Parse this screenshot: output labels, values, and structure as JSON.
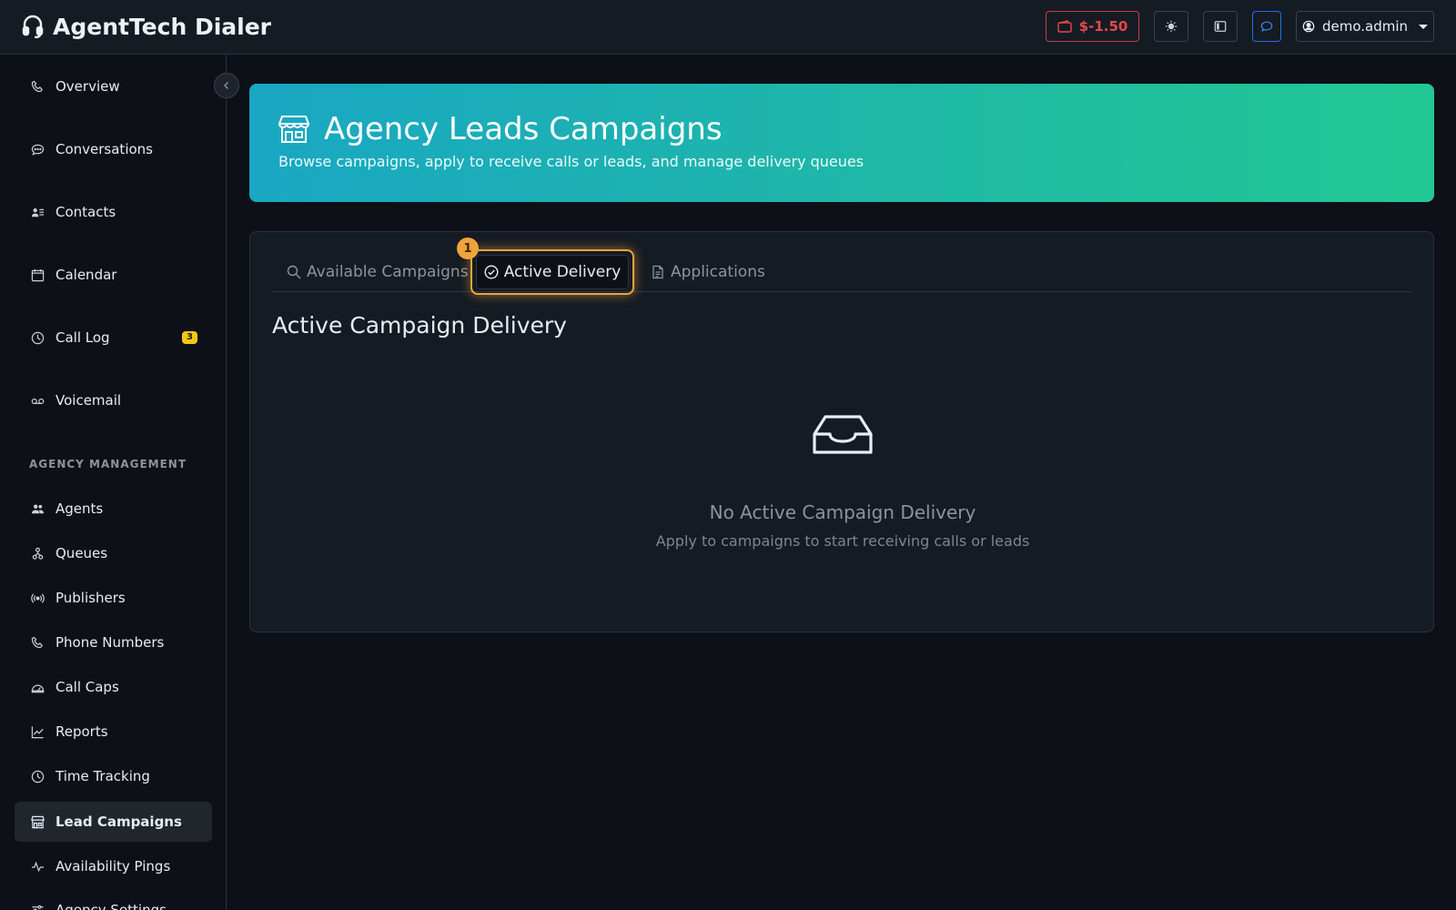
{
  "app": {
    "title": "AgentTech Dialer"
  },
  "header": {
    "wallet_balance": "$-1.50",
    "user_label": "demo.admin"
  },
  "sidebar": {
    "items": [
      {
        "label": "Overview",
        "icon": "phone-icon"
      },
      {
        "label": "Conversations",
        "icon": "chat-icon"
      },
      {
        "label": "Contacts",
        "icon": "contacts-icon"
      },
      {
        "label": "Calendar",
        "icon": "calendar-icon"
      },
      {
        "label": "Call Log",
        "icon": "clock-icon",
        "badge": "3"
      },
      {
        "label": "Voicemail",
        "icon": "voicemail-icon"
      }
    ],
    "section_title": "AGENCY MANAGEMENT",
    "management_items": [
      {
        "label": "Agents",
        "icon": "people-icon"
      },
      {
        "label": "Queues",
        "icon": "queue-icon"
      },
      {
        "label": "Publishers",
        "icon": "broadcast-icon"
      },
      {
        "label": "Phone Numbers",
        "icon": "phone-icon"
      },
      {
        "label": "Call Caps",
        "icon": "gauge-icon"
      },
      {
        "label": "Reports",
        "icon": "chart-line-icon"
      },
      {
        "label": "Time Tracking",
        "icon": "clock-icon"
      },
      {
        "label": "Lead Campaigns",
        "icon": "shop-icon",
        "active": true
      },
      {
        "label": "Availability Pings",
        "icon": "pulse-icon"
      },
      {
        "label": "Agency Settings",
        "icon": "sliders-icon"
      }
    ]
  },
  "hero": {
    "title": "Agency Leads Campaigns",
    "subtitle": "Browse campaigns, apply to receive calls or leads, and manage delivery queues"
  },
  "tabs": {
    "available": "Available Campaigns",
    "active": "Active Delivery",
    "applications": "Applications",
    "step_badge": "1"
  },
  "content": {
    "heading": "Active Campaign Delivery",
    "empty_title": "No Active Campaign Delivery",
    "empty_subtitle": "Apply to campaigns to start receiving calls or leads"
  },
  "colors": {
    "accent": "#f0a33c",
    "hero_start": "#19a7c3",
    "hero_end": "#22c893",
    "wallet_negative": "#e5484d"
  }
}
